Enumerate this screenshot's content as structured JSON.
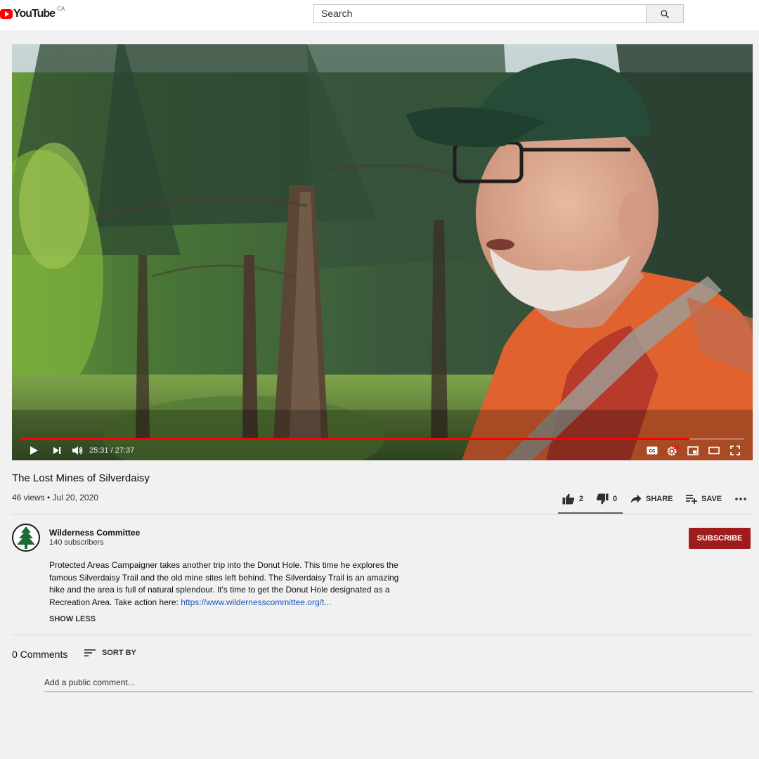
{
  "header": {
    "logo_text": "YouTube",
    "country_code": "CA",
    "search_placeholder": "Search"
  },
  "player": {
    "current_time": "25:31",
    "separator": " / ",
    "duration": "27:37",
    "progress_played": 0.924,
    "progress_buffered": 0.95
  },
  "video": {
    "title": "The Lost Mines of Silverdaisy",
    "views": "46 views",
    "dot": " • ",
    "date": "Jul 20, 2020",
    "likes": "2",
    "dislikes": "0",
    "like_ratio": 1.0,
    "share_label": "SHARE",
    "save_label": "SAVE"
  },
  "channel": {
    "name": "Wilderness Committee",
    "subscribers": "140 subscribers",
    "subscribe_label": "SUBSCRIBE"
  },
  "description": {
    "text": "Protected Areas Campaigner takes another trip into the Donut Hole. This time he explores the famous Silverdaisy Trail and the old mine sites left behind. The Silverdaisy Trail is an amazing hike and the area is full of natural splendour. It's time to get the Donut Hole designated as a Recreation Area. Take action here: ",
    "link": "https://www.wildernesscommittee.org/t...",
    "toggle_label": "SHOW LESS"
  },
  "comments": {
    "count_label": "0 Comments",
    "sort_label": "SORT BY",
    "input_placeholder": "Add a public comment..."
  },
  "colors": {
    "brand_red": "#ff0000",
    "subscribe_red": "#a01c1c",
    "link_blue": "#1a56b8",
    "background": "#f1f1f1"
  }
}
